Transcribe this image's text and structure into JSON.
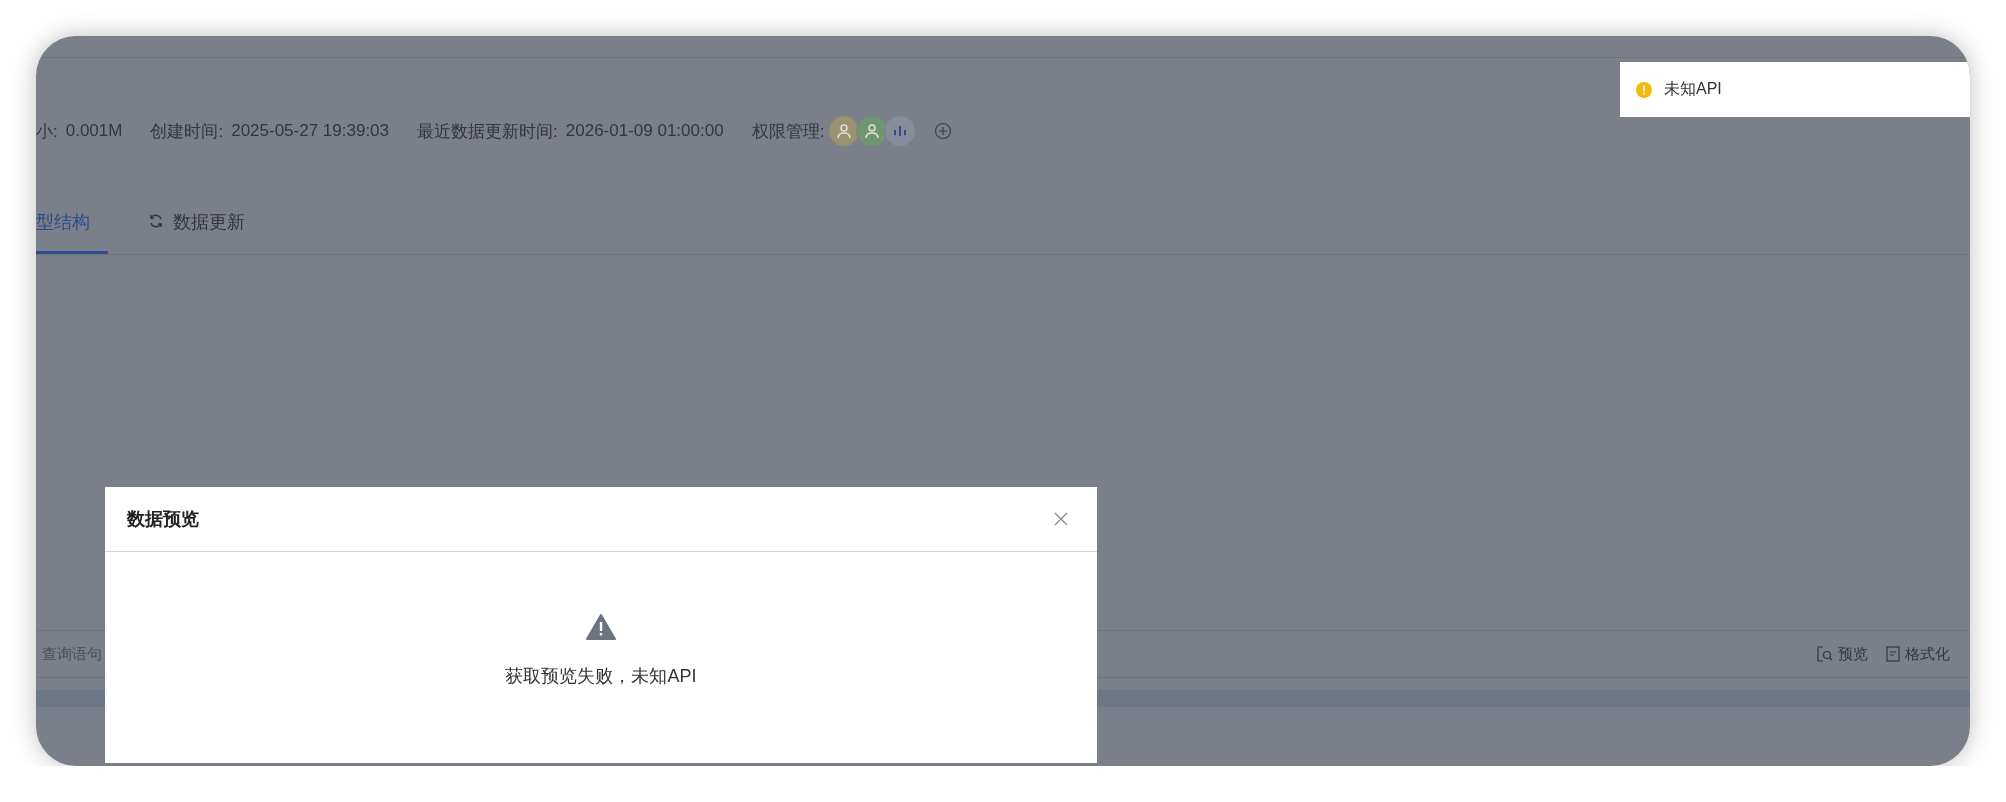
{
  "info": [
    {
      "label": "小:",
      "value": "0.001M"
    },
    {
      "label": "创建时间:",
      "value": "2025-05-27 19:39:03"
    },
    {
      "label": "最近数据更新时间:",
      "value": "2026-01-09 01:00:00"
    }
  ],
  "permission": {
    "label": "权限管理:",
    "avatars": [
      {
        "kind": "user",
        "color": "#9a9272"
      },
      {
        "kind": "user",
        "color": "#6f9670"
      },
      {
        "kind": "bars",
        "color": "#878d9a"
      }
    ]
  },
  "tabs": [
    {
      "label": "型结构",
      "kind": "plain",
      "selected": true
    },
    {
      "label": "数据更新",
      "kind": "sync",
      "selected": false
    }
  ],
  "editor": {
    "hint": "查询语句",
    "actions": [
      {
        "kind": "preview",
        "label": "预览"
      },
      {
        "kind": "format",
        "label": "格式化"
      }
    ]
  },
  "dialog": {
    "title": "数据预览",
    "message": "获取预览失败，未知API"
  },
  "toast": {
    "kind": "warning",
    "text": "未知API"
  }
}
